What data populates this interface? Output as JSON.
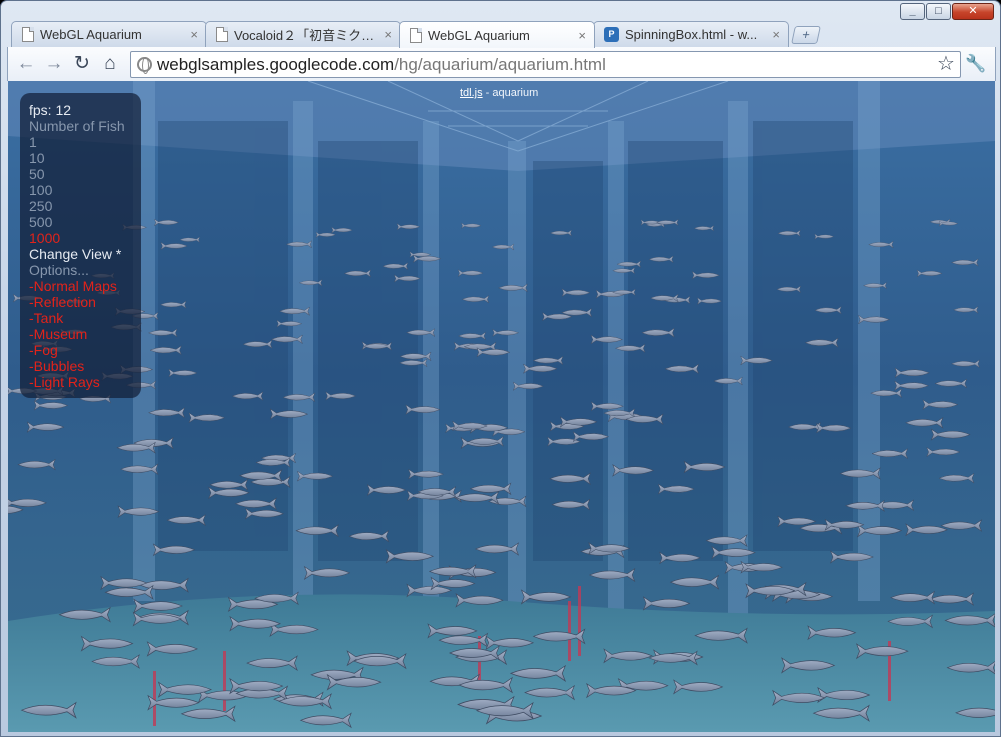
{
  "window": {
    "controls": [
      "_",
      "□",
      "✕"
    ]
  },
  "tabs": [
    {
      "title": "WebGL Aquarium",
      "icon": "page-icon",
      "active": false
    },
    {
      "title": "Vocaloid２「初音ミク」...",
      "icon": "page-icon",
      "active": false
    },
    {
      "title": "WebGL Aquarium",
      "icon": "page-icon",
      "active": true
    },
    {
      "title": "SpinningBox.html - w...",
      "icon": "p-icon",
      "active": false
    }
  ],
  "toolbar": {
    "back_icon": "←",
    "forward_icon": "→",
    "reload_icon": "↻",
    "home_icon": "⌂",
    "url_host": "webglsamples.googlecode.com",
    "url_path": "/hg/aquarium/aquarium.html",
    "star_icon": "☆",
    "wrench_icon": "🔧"
  },
  "page": {
    "credit_link": "tdl.js",
    "credit_rest": " - aquarium",
    "hud": {
      "fps": "fps: 12",
      "number_label": "Number of Fish",
      "fish_counts": [
        "1",
        "10",
        "50",
        "100",
        "250",
        "500",
        "1000"
      ],
      "selected_count": "1000",
      "change_view": "Change View *",
      "options": "Options...",
      "toggles": [
        "-Normal Maps",
        "-Reflection",
        "-Tank",
        "-Museum",
        "-Fog",
        "-Bubbles",
        "-Light Rays"
      ]
    }
  },
  "colors": {
    "water": "#2b5380",
    "hud_red": "#e2231a",
    "hud_muted": "#8797ad"
  }
}
